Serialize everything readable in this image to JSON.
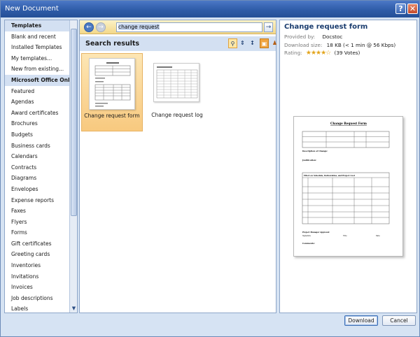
{
  "window": {
    "title": "New Document"
  },
  "left_panel": {
    "items": [
      {
        "label": "Templates",
        "style": "header"
      },
      {
        "label": "Blank and recent",
        "style": ""
      },
      {
        "label": "Installed Templates",
        "style": ""
      },
      {
        "label": "My templates...",
        "style": ""
      },
      {
        "label": "New from existing...",
        "style": ""
      },
      {
        "label": "Microsoft Office Online",
        "style": "header"
      },
      {
        "label": "Featured",
        "style": ""
      },
      {
        "label": "Agendas",
        "style": ""
      },
      {
        "label": "Award certificates",
        "style": ""
      },
      {
        "label": "Brochures",
        "style": ""
      },
      {
        "label": "Budgets",
        "style": ""
      },
      {
        "label": "Business cards",
        "style": ""
      },
      {
        "label": "Calendars",
        "style": ""
      },
      {
        "label": "Contracts",
        "style": ""
      },
      {
        "label": "Diagrams",
        "style": ""
      },
      {
        "label": "Envelopes",
        "style": ""
      },
      {
        "label": "Expense reports",
        "style": ""
      },
      {
        "label": "Faxes",
        "style": ""
      },
      {
        "label": "Flyers",
        "style": ""
      },
      {
        "label": "Forms",
        "style": ""
      },
      {
        "label": "Gift certificates",
        "style": ""
      },
      {
        "label": "Greeting cards",
        "style": ""
      },
      {
        "label": "Inventories",
        "style": ""
      },
      {
        "label": "Invitations",
        "style": ""
      },
      {
        "label": "Invoices",
        "style": ""
      },
      {
        "label": "Job descriptions",
        "style": ""
      },
      {
        "label": "Labels",
        "style": ""
      }
    ]
  },
  "search": {
    "query": "change request",
    "results_header": "Search results",
    "results": [
      {
        "label": "Change request form",
        "selected": true
      },
      {
        "label": "Change request log",
        "selected": false
      }
    ]
  },
  "preview": {
    "title": "Change request form",
    "provided_by_label": "Provided by:",
    "provided_by": "Docstoc",
    "download_size_label": "Download size:",
    "download_size": "18 KB (< 1 min @ 56 Kbps)",
    "rating_label": "Rating:",
    "rating_stars": 4,
    "rating_votes": "(39 Votes)",
    "doc": {
      "heading": "Change Request Form",
      "description_label": "Description of Change:",
      "justification_label": "Justification:",
      "effect_label": "Effect on Schedule, Deliverables, and Project Cost",
      "approval_label": "Project Manager Approval:",
      "signature_label": "Signature",
      "title_label": "Title",
      "date_label": "Date",
      "comments_label": "Comments:"
    }
  },
  "buttons": {
    "download": "Download",
    "cancel": "Cancel"
  },
  "colors": {
    "title_bar": "#2f5ca8",
    "selection": "#f8c97f",
    "panel_header": "#d3e0f2"
  }
}
